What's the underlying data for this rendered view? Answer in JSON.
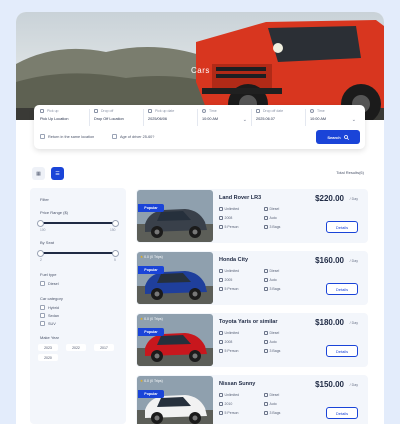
{
  "hero": {
    "title": "Cars"
  },
  "search": {
    "fields": [
      {
        "label": "Pick up",
        "value": "Pick Up Location"
      },
      {
        "label": "Drop off",
        "value": "Drop Off Location"
      },
      {
        "label": "Pick up date",
        "value": "2025/06/06"
      },
      {
        "label": "Time",
        "value": "10:00 AM"
      },
      {
        "label": "Drop off date",
        "value": "2025.06.07"
      },
      {
        "label": "Time",
        "value": "10:00 AM"
      }
    ],
    "return_same": "Return in the same location",
    "driver_age": "Age of driver 25-60?",
    "button": "Search"
  },
  "results": {
    "total": "Total Results(6)"
  },
  "filters": {
    "title": "Filter",
    "price_label": "Price Range ($)",
    "price_min": "100",
    "price_max": "150",
    "seat_label": "By Seat",
    "seat_min": "2",
    "seat_max": "5",
    "fuel_label": "Fuel type",
    "fuel_options": [
      "Diesel"
    ],
    "category_label": "Car category",
    "category_options": [
      "Hybrid",
      "Sedan",
      "SUV"
    ],
    "year_label": "Make Year",
    "years": [
      "2023",
      "2022",
      "2017",
      "2020"
    ]
  },
  "cars": [
    {
      "name": "Land Rover LR3",
      "price": "$220.00",
      "per": "/ Day",
      "badge": "Popular",
      "rating": "",
      "mileage": "Unlimited",
      "fuel": "Diesel",
      "year": "2008",
      "transmission": "Auto",
      "seats": "5 Person",
      "bags": "3 Bags",
      "details": "Details",
      "color": "#39404a"
    },
    {
      "name": "Honda City",
      "price": "$160.00",
      "per": "/ Day",
      "badge": "Popular",
      "rating": "0.0 (0 Trips)",
      "mileage": "Unlimited",
      "fuel": "Diesel",
      "year": "2005",
      "transmission": "Auto",
      "seats": "5 Person",
      "bags": "3 Bags",
      "details": "Details",
      "color": "#1f3f9c"
    },
    {
      "name": "Toyota Yaris or similar",
      "price": "$180.00",
      "per": "/ Day",
      "badge": "Popular",
      "rating": "0.0 (0 Trips)",
      "mileage": "Unlimited",
      "fuel": "Diesel",
      "year": "2008",
      "transmission": "Auto",
      "seats": "5 Person",
      "bags": "3 Bags",
      "details": "Details",
      "color": "#c8171d"
    },
    {
      "name": "Nissan Sunny",
      "price": "$150.00",
      "per": "/ Day",
      "badge": "Popular",
      "rating": "0.0 (0 Trips)",
      "mileage": "Unlimited",
      "fuel": "Diesel",
      "year": "2010",
      "transmission": "Auto",
      "seats": "5 Person",
      "bags": "3 Bags",
      "details": "Details",
      "color": "#f2f2f2"
    }
  ],
  "colors": {
    "accent": "#1a44d8",
    "panel": "#f3f6fb",
    "page": "#e3ecfb"
  }
}
